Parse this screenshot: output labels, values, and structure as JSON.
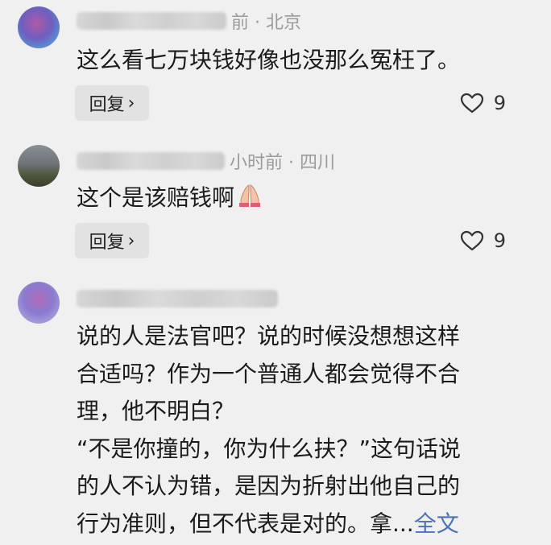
{
  "comments": [
    {
      "meta_suffix": "前 · 北京",
      "text": "这么看七万块钱好像也没那么冤枉了。",
      "reply_label": "回复",
      "like_icon": "heart-outline-icon",
      "like_count": "9"
    },
    {
      "meta_suffix": "小时前 · 四川",
      "text": "这个是该赔钱啊",
      "text_emoji": "folded-hands-icon",
      "reply_label": "回复",
      "like_icon": "heart-outline-icon",
      "like_count": "9"
    },
    {
      "lines": [
        "说的人是法官吧？说的时候没想想这样",
        "合适吗？作为一个普通人都会觉得不合",
        "理，他不明白？",
        "“不是你撞的，你为什么扶？”这句话说",
        "的人不认为错，是因为折射出他自己的",
        "行为准则，但不代表是对的。拿..."
      ],
      "expand_label": "全文"
    }
  ],
  "colors": {
    "background": "#f0f0f0",
    "meta_text": "#9b9b9b",
    "link": "#4a72b8",
    "reply_bg": "#e2e2e2"
  }
}
